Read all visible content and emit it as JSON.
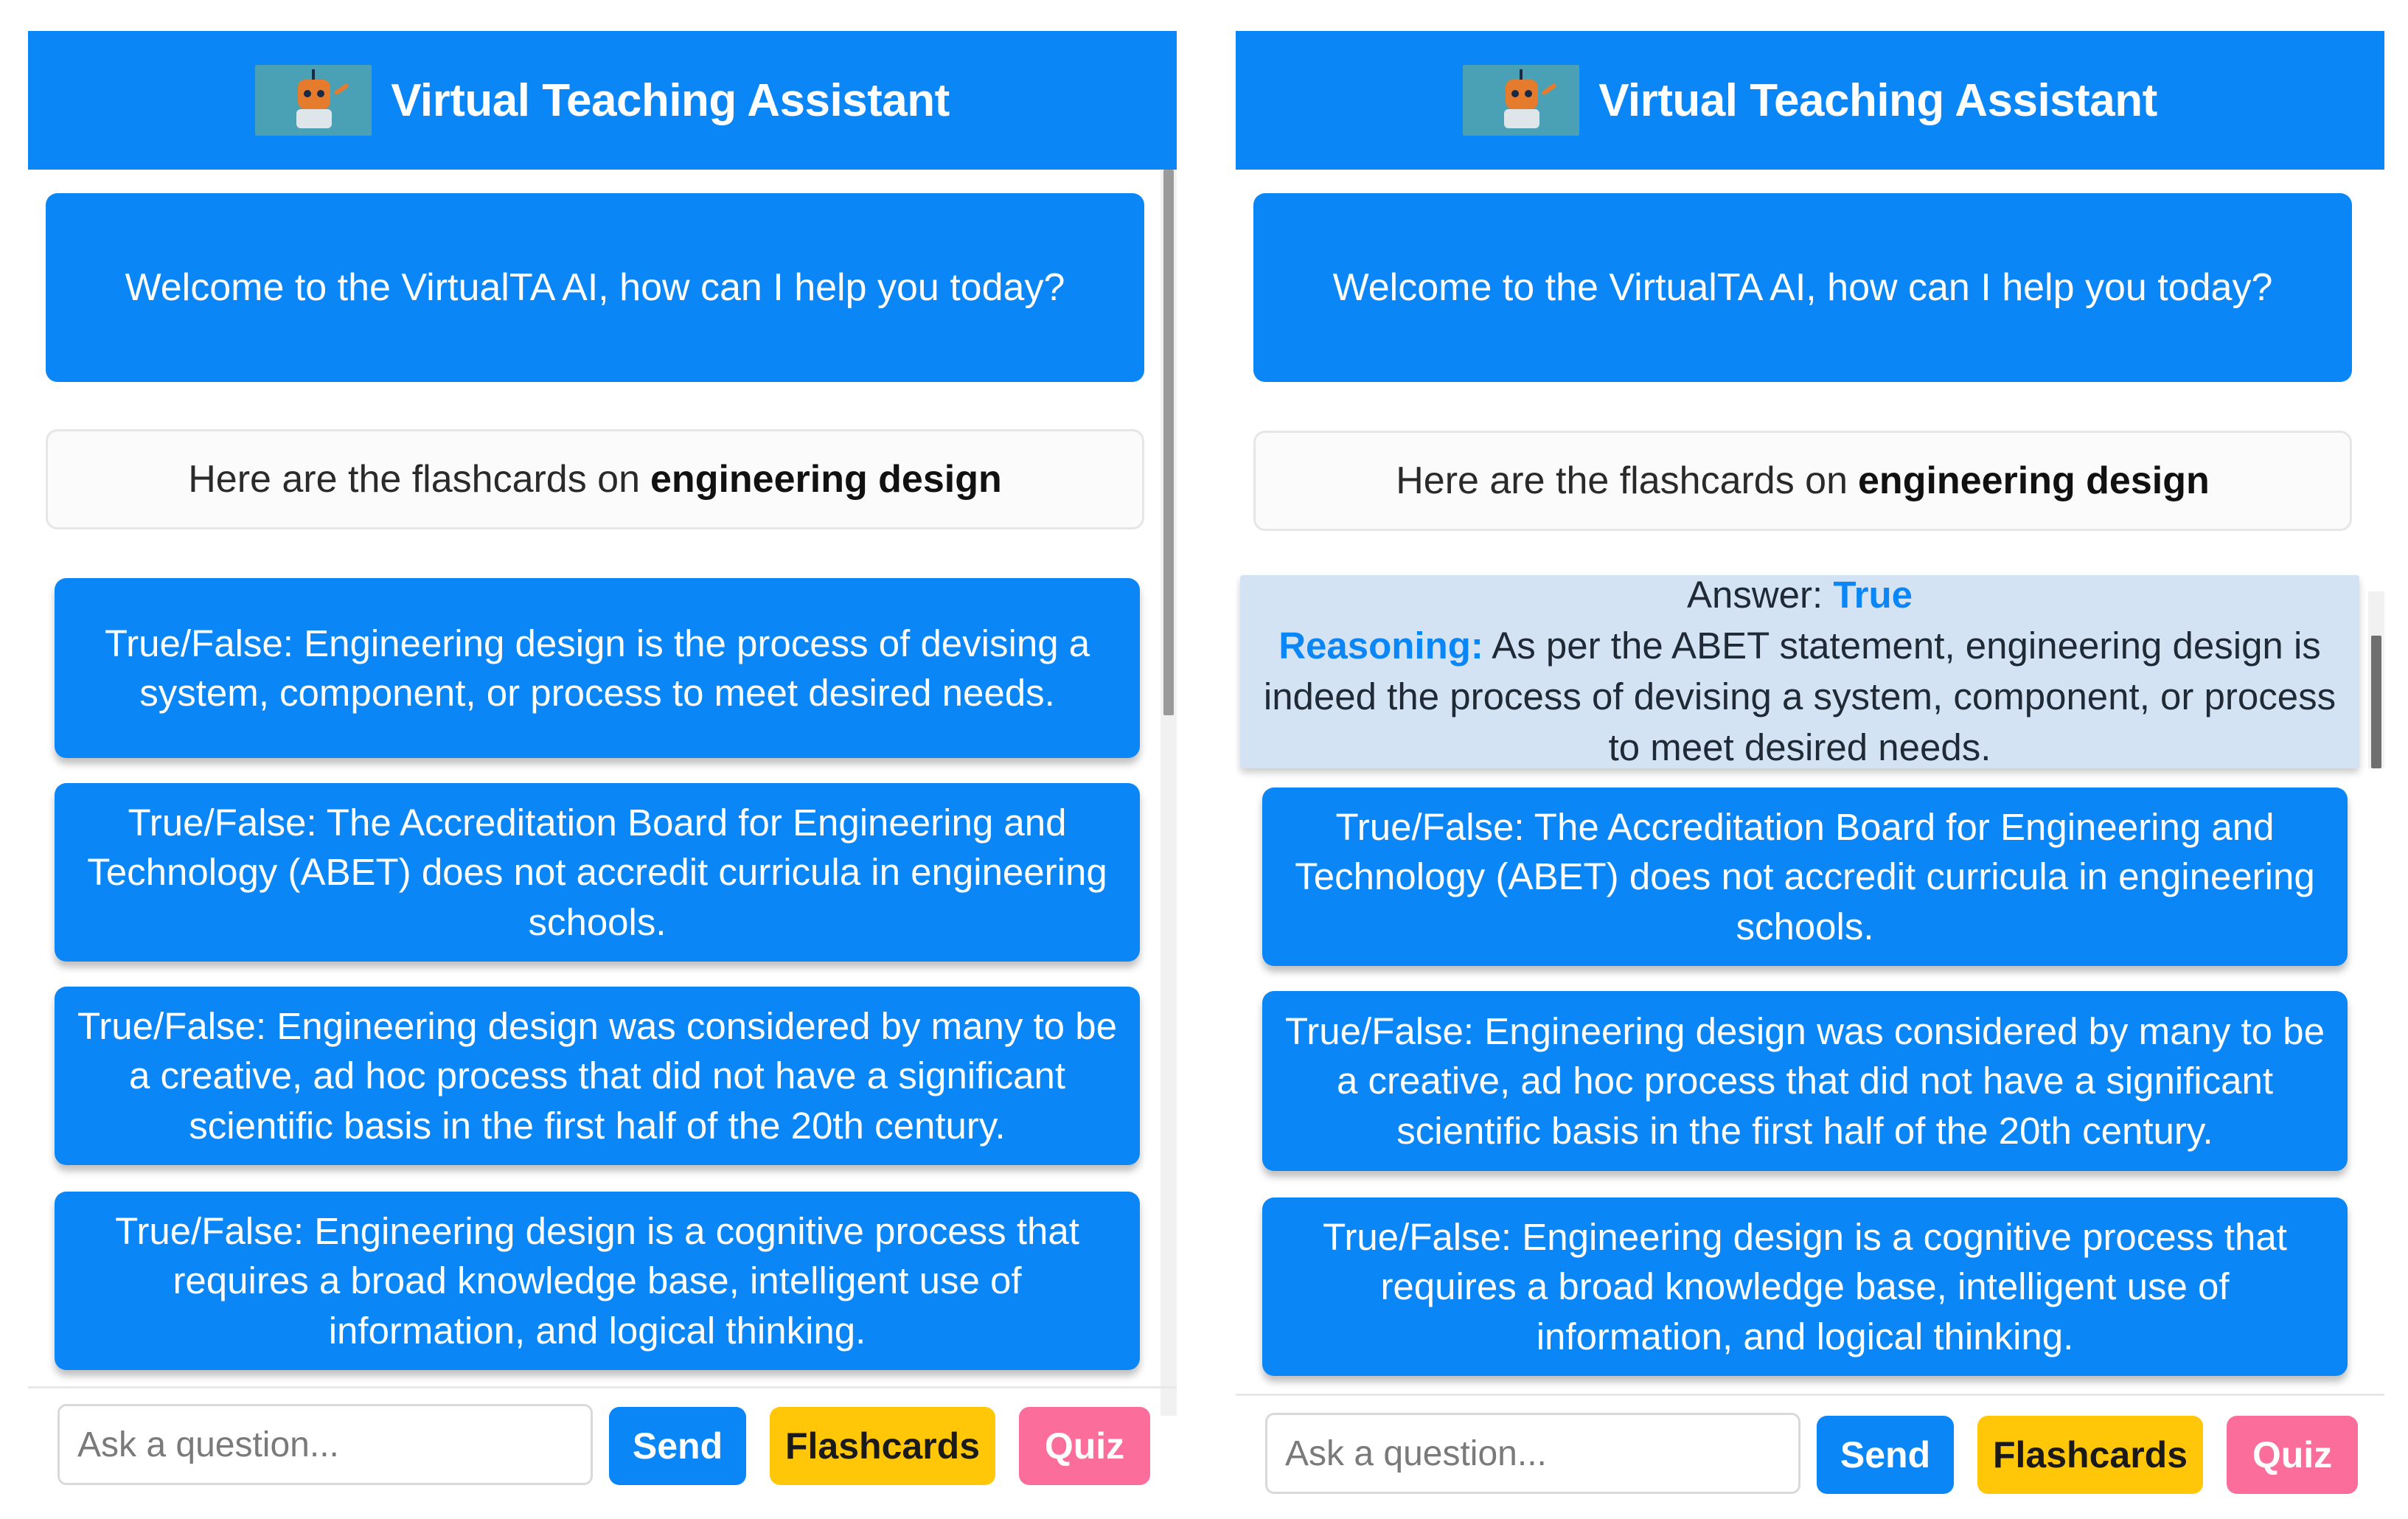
{
  "header": {
    "title": "Virtual Teaching Assistant",
    "logo_icon": "robot-logo-icon"
  },
  "chat": {
    "welcome": "Welcome to the VirtualTA AI, how can I help you today?",
    "topic_prefix": "Here are the flashcards on",
    "topic_bold": "engineering design"
  },
  "flashcards": [
    "True/False: Engineering design is the process of devising a system, component, or process to meet desired needs.",
    "True/False: The Accreditation Board for Engineering and Technology (ABET) does not accredit curricula in engineering schools.",
    "True/False: Engineering design was considered by many to be a creative, ad hoc process that did not have a significant scientific basis in the first half of the 20th century.",
    "True/False: Engineering design is a cognitive process that requires a broad knowledge base, intelligent use of information, and logical thinking."
  ],
  "answer_card": {
    "answer_label": "Answer:",
    "answer_value": "True",
    "reasoning_label": "Reasoning:",
    "reasoning_text": "As per the ABET statement, engineering design is indeed the process of devising a system, component, or process to meet desired needs."
  },
  "footer": {
    "input_placeholder": "Ask a question...",
    "send_label": "Send",
    "flashcards_label": "Flashcards",
    "quiz_label": "Quiz"
  },
  "colors": {
    "primary": "#0a86f7",
    "flashcards_button": "#ffc708",
    "quiz_button": "#fb6d9b",
    "answer_card_bg": "#d4e3f4"
  }
}
